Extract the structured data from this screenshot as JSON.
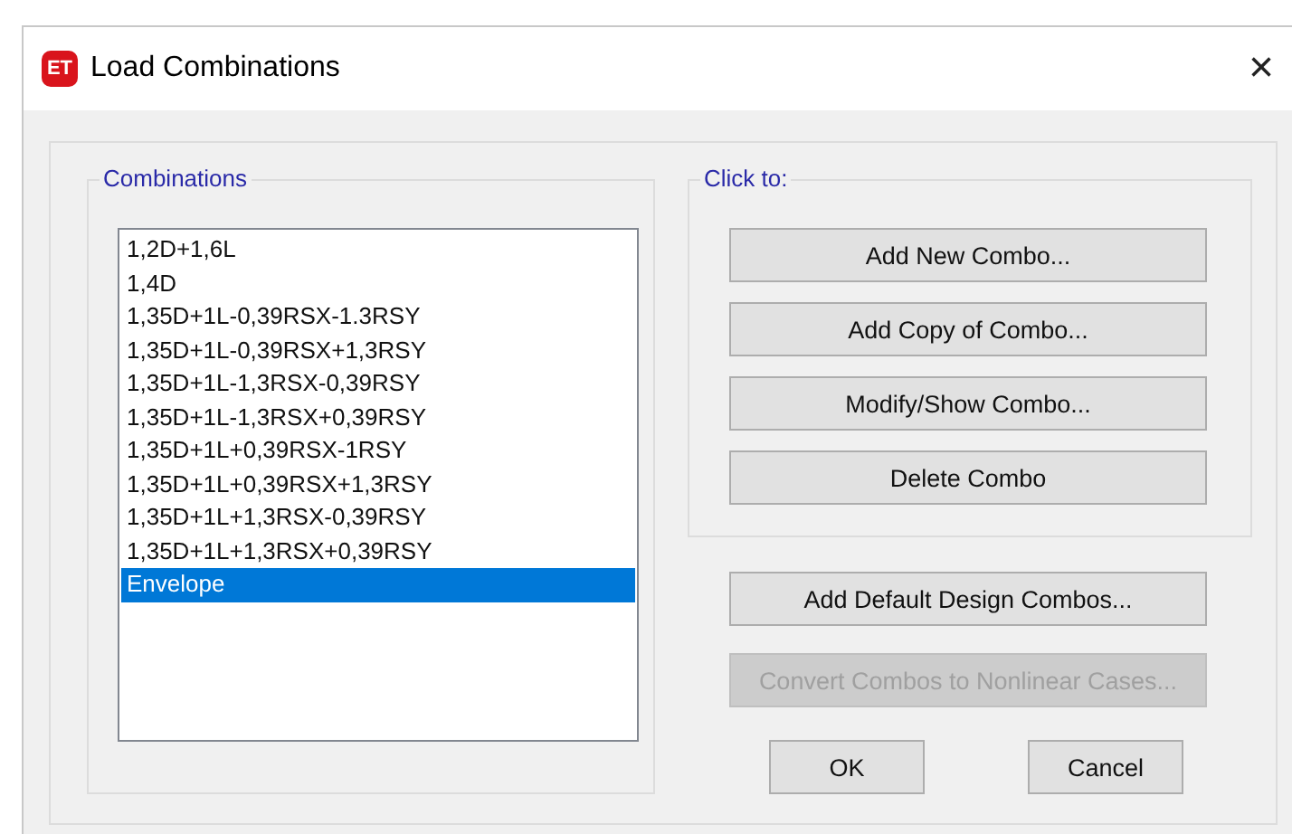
{
  "window": {
    "title": "Load Combinations",
    "app_badge": "ET",
    "close": "×"
  },
  "combinations": {
    "label": "Combinations",
    "items": [
      {
        "name": "1,2D+1,6L",
        "selected": false
      },
      {
        "name": "1,4D",
        "selected": false
      },
      {
        "name": "1,35D+1L-0,39RSX-1.3RSY",
        "selected": false
      },
      {
        "name": "1,35D+1L-0,39RSX+1,3RSY",
        "selected": false
      },
      {
        "name": "1,35D+1L-1,3RSX-0,39RSY",
        "selected": false
      },
      {
        "name": "1,35D+1L-1,3RSX+0,39RSY",
        "selected": false
      },
      {
        "name": "1,35D+1L+0,39RSX-1RSY",
        "selected": false
      },
      {
        "name": "1,35D+1L+0,39RSX+1,3RSY",
        "selected": false
      },
      {
        "name": "1,35D+1L+1,3RSX-0,39RSY",
        "selected": false
      },
      {
        "name": "1,35D+1L+1,3RSX+0,39RSY",
        "selected": false
      },
      {
        "name": "Envelope",
        "selected": true
      }
    ]
  },
  "click_to": {
    "label": "Click to:",
    "buttons": [
      {
        "label": "Add New Combo...",
        "disabled": false
      },
      {
        "label": "Add Copy of Combo...",
        "disabled": false
      },
      {
        "label": "Modify/Show Combo...",
        "disabled": false
      },
      {
        "label": "Delete Combo",
        "disabled": false
      }
    ]
  },
  "extra_buttons": [
    {
      "label": "Add Default Design Combos...",
      "disabled": false
    },
    {
      "label": "Convert Combos to Nonlinear Cases...",
      "disabled": true
    }
  ],
  "dialog_buttons": [
    "OK",
    "Cancel"
  ]
}
